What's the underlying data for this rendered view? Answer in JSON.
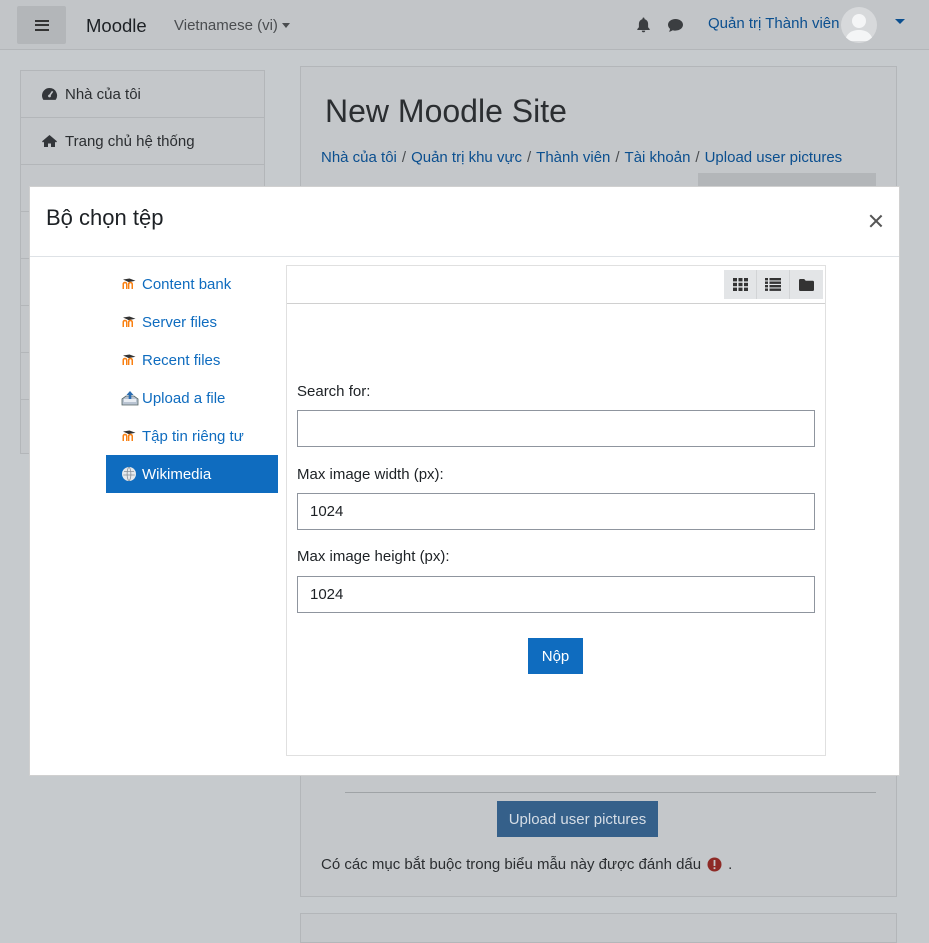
{
  "navbar": {
    "brand": "Moodle",
    "language": "Vietnamese (vi)",
    "username": "Quản trị Thành viên",
    "icons": [
      "menu-icon",
      "bell-icon",
      "chat-icon",
      "avatar",
      "caret-down-icon"
    ]
  },
  "drawer": {
    "items": [
      {
        "label": "Nhà của tôi",
        "icon": "dashboard-icon"
      },
      {
        "label": "Trang chủ hệ thống",
        "icon": "home-icon"
      },
      {
        "label": "",
        "icon": ""
      },
      {
        "label": "",
        "icon": ""
      },
      {
        "label": "",
        "icon": ""
      },
      {
        "label": "",
        "icon": ""
      },
      {
        "label": "",
        "icon": ""
      },
      {
        "label": "",
        "icon": ""
      }
    ]
  },
  "main": {
    "site_title": "New Moodle Site",
    "breadcrumb": [
      "Nhà của tôi",
      "Quản trị khu vực",
      "Thành viên",
      "Tài khoản",
      "Upload user pictures"
    ],
    "upload_button": "Upload user pictures",
    "required_note_prefix": "Có các mục bắt buộc trong biểu mẫu này được đánh dấu",
    "required_note_suffix": "."
  },
  "modal": {
    "title": "Bộ chọn tệp",
    "repositories": [
      {
        "label": "Content bank",
        "icon": "moodle-icon",
        "active": false
      },
      {
        "label": "Server files",
        "icon": "moodle-icon",
        "active": false
      },
      {
        "label": "Recent files",
        "icon": "moodle-icon",
        "active": false
      },
      {
        "label": "Upload a file",
        "icon": "upload-icon",
        "active": false
      },
      {
        "label": "Tập tin riêng tư",
        "icon": "moodle-icon",
        "active": false
      },
      {
        "label": "Wikimedia",
        "icon": "wikimedia-icon",
        "active": true
      }
    ],
    "view_buttons": [
      "grid-view-icon",
      "list-view-icon",
      "folder-view-icon"
    ],
    "form": {
      "search_label": "Search for:",
      "search_value": "",
      "width_label": "Max image width (px):",
      "width_value": "1024",
      "height_label": "Max image height (px):",
      "height_value": "1024",
      "submit_label": "Nộp"
    }
  },
  "colors": {
    "accent": "#0f6cbf",
    "overlay_bg": "#c6cacd",
    "modal_bg": "#ffffff"
  }
}
